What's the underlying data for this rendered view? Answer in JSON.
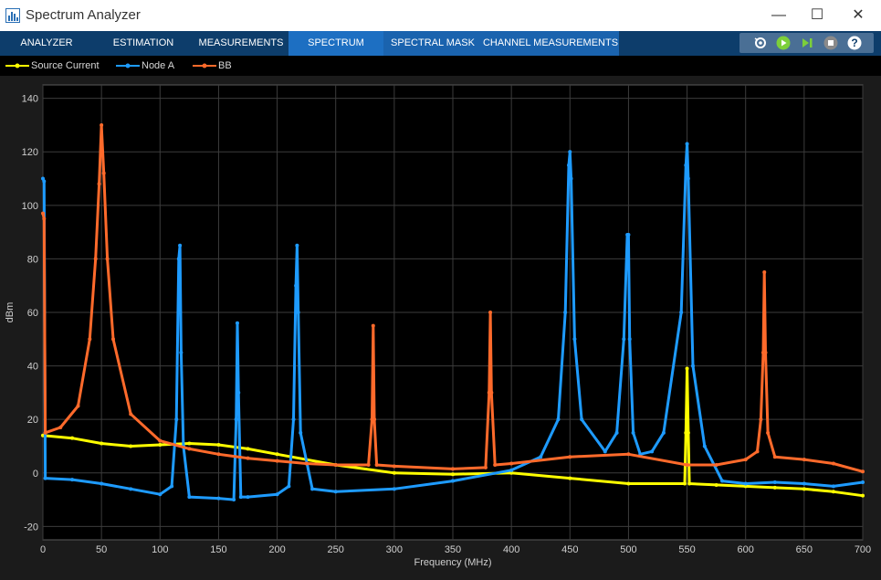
{
  "window": {
    "title": "Spectrum Analyzer",
    "minimize_glyph": "—",
    "maximize_glyph": "☐",
    "close_glyph": "✕"
  },
  "toolbar": {
    "tabs": [
      "ANALYZER",
      "ESTIMATION",
      "MEASUREMENTS",
      "SPECTRUM",
      "SPECTRAL MASK",
      "CHANNEL MEASUREMENTS"
    ],
    "active_tab": "SPECTRUM",
    "tools": [
      "settings-icon",
      "run-icon",
      "step-icon",
      "stop-icon",
      "help-icon"
    ]
  },
  "colors": {
    "source_current": "#ffff00",
    "node_a": "#1e9bff",
    "bb": "#ff6a2b",
    "plot_bg": "#000000",
    "toolbar_bg": "#0d3d6b",
    "active_tab": "#1d6fc2"
  },
  "chart_data": {
    "type": "line",
    "title": "",
    "xlabel": "Frequency (MHz)",
    "ylabel": "dBm",
    "xlim": [
      0,
      700
    ],
    "ylim": [
      -25,
      145
    ],
    "xticks": [
      0,
      50,
      100,
      150,
      200,
      250,
      300,
      350,
      400,
      450,
      500,
      550,
      600,
      650,
      700
    ],
    "yticks": [
      -20,
      0,
      20,
      40,
      60,
      80,
      100,
      120,
      140
    ],
    "grid": true,
    "legend_position": "top",
    "series": [
      {
        "name": "Source Current",
        "color": "#ffff00",
        "x": [
          0,
          25,
          50,
          75,
          100,
          125,
          150,
          175,
          200,
          250,
          300,
          350,
          400,
          450,
          500,
          548,
          549,
          550,
          551,
          552,
          575,
          600,
          625,
          650,
          675,
          700
        ],
        "y": [
          14,
          13,
          11,
          10,
          10.5,
          11,
          10.5,
          9,
          7,
          3,
          0,
          -0.5,
          0,
          -2,
          -4,
          -4,
          15,
          39,
          15,
          -4,
          -4.5,
          -5,
          -5.5,
          -6,
          -7,
          -8.5
        ]
      },
      {
        "name": "Node A",
        "color": "#1e9bff",
        "x": [
          0,
          1,
          2,
          25,
          50,
          75,
          100,
          110,
          114,
          116,
          117,
          118,
          120,
          125,
          150,
          163,
          165,
          166,
          167,
          169,
          175,
          200,
          210,
          214,
          216,
          217,
          218,
          220,
          230,
          250,
          300,
          350,
          400,
          425,
          440,
          446,
          449,
          450,
          451,
          454,
          460,
          480,
          490,
          496,
          499,
          500,
          501,
          504,
          510,
          520,
          530,
          545,
          549,
          550,
          551,
          555,
          565,
          580,
          600,
          625,
          650,
          675,
          700
        ],
        "y": [
          110,
          109,
          -2,
          -2.5,
          -4,
          -6,
          -8,
          -5,
          20,
          80,
          85,
          45,
          10,
          -9,
          -9.5,
          -10,
          20,
          56,
          30,
          -9,
          -9,
          -8,
          -5,
          20,
          70,
          85,
          60,
          15,
          -6,
          -7,
          -6,
          -3,
          1,
          6,
          20,
          60,
          115,
          120,
          110,
          50,
          20,
          8,
          15,
          50,
          89,
          89,
          50,
          15,
          7,
          8,
          15,
          60,
          115,
          123,
          110,
          40,
          10,
          -3,
          -4,
          -3.5,
          -4,
          -5,
          -3.5
        ]
      },
      {
        "name": "BB",
        "color": "#ff6a2b",
        "x": [
          0,
          1,
          2,
          15,
          30,
          40,
          45,
          48,
          50,
          52,
          55,
          60,
          75,
          100,
          125,
          150,
          175,
          200,
          225,
          250,
          278,
          281,
          282,
          283,
          285,
          300,
          350,
          378,
          381,
          382,
          383,
          386,
          400,
          450,
          500,
          550,
          575,
          600,
          610,
          613,
          615,
          616,
          617,
          619,
          625,
          650,
          675,
          700
        ],
        "y": [
          97,
          95,
          15,
          17,
          25,
          50,
          80,
          108,
          130,
          112,
          80,
          50,
          22,
          12,
          9,
          7,
          5.5,
          4.5,
          3.5,
          3,
          3,
          20,
          55,
          20,
          3,
          2.5,
          1.5,
          2,
          30,
          60,
          30,
          3,
          3.5,
          6,
          7,
          3,
          3,
          5,
          8,
          20,
          45,
          75,
          45,
          15,
          6,
          5,
          3.5,
          0.5
        ]
      }
    ]
  }
}
